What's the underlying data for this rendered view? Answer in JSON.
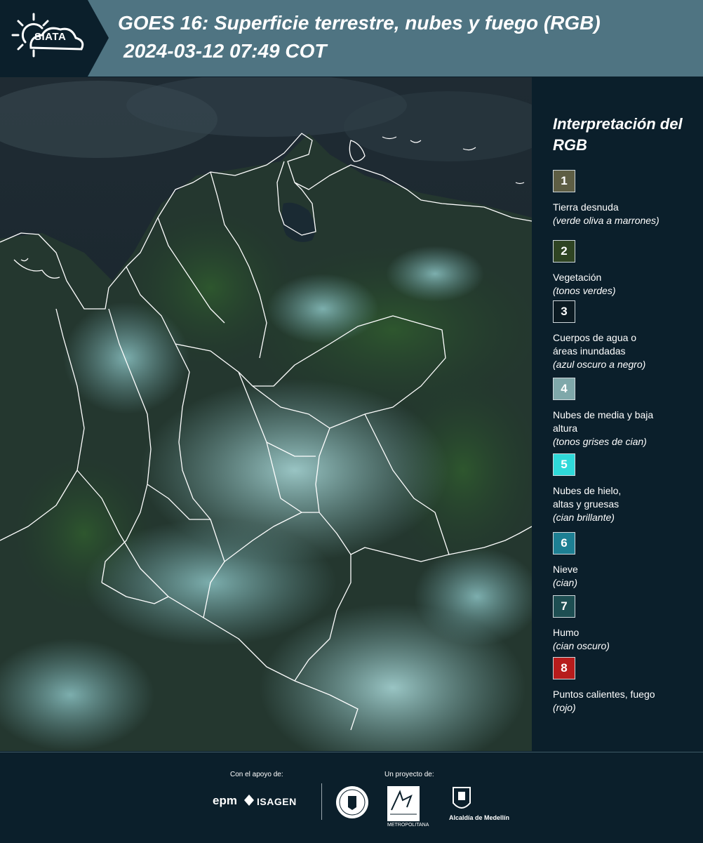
{
  "header": {
    "logo_text": "SIATA",
    "title": "GOES 16: Superficie terrestre, nubes y fuego (RGB)",
    "timestamp": "2024-03-12 07:49 COT"
  },
  "map": {
    "icon": "satellite-rgb-map"
  },
  "legend": {
    "title": "Interpretación del RGB",
    "items": [
      {
        "number": "1",
        "color": "#5e5e44",
        "label": "Tierra desnuda",
        "note": "(verde oliva a marrones)"
      },
      {
        "number": "2",
        "color": "#2f4423",
        "label": "Vegetación",
        "note": "(tonos verdes)"
      },
      {
        "number": "3",
        "color": "#0b1a22",
        "label": "Cuerpos de agua o áreas inundadas",
        "note": "(azul oscuro a negro)"
      },
      {
        "number": "4",
        "color": "#7fa8aa",
        "label": "Nubes de media y baja altura",
        "note": "(tonos grises de cian)"
      },
      {
        "number": "5",
        "color": "#2fd9d9",
        "label": "Nubes de hielo, altas y gruesas",
        "note": "(cian brillante)"
      },
      {
        "number": "6",
        "color": "#1d7f93",
        "label": "Nieve",
        "note": "(cian)"
      },
      {
        "number": "7",
        "color": "#1d4e52",
        "label": "Humo",
        "note": "(cian oscuro)"
      },
      {
        "number": "8",
        "color": "#b71c1c",
        "label": "Puntos calientes, fuego",
        "note": "(rojo)"
      }
    ]
  },
  "footer": {
    "support_label": "Con el apoyo de:",
    "project_label": "Un proyecto de:",
    "epm": "epm",
    "isagen": "ISAGEN",
    "metropolitana": "METROPOLITANA",
    "alcaldia": "Alcaldía de Medellín"
  }
}
